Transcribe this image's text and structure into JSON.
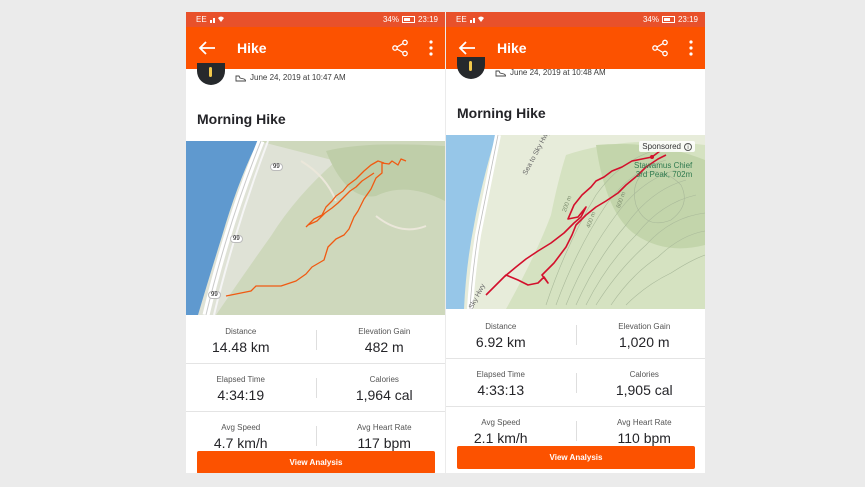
{
  "colors": {
    "accent": "#fc5200",
    "route_left": "#f05a12",
    "route_right": "#d3102c"
  },
  "phones": [
    {
      "status": {
        "carrier": "EE",
        "battery": "34%",
        "time": "23:19"
      },
      "header": {
        "title": "Hike"
      },
      "activity": {
        "date": "June 24, 2019 at 10:47 AM",
        "name": "Morning Hike"
      },
      "map": {
        "road_badges": [
          "99",
          "99",
          "99"
        ]
      },
      "stats": [
        {
          "label": "Distance",
          "value": "14.48 km"
        },
        {
          "label": "Elevation Gain",
          "value": "482 m"
        },
        {
          "label": "Elapsed Time",
          "value": "4:34:19"
        },
        {
          "label": "Calories",
          "value": "1,964 cal"
        },
        {
          "label": "Avg Speed",
          "value": "4.7 km/h"
        },
        {
          "label": "Avg Heart Rate",
          "value": "117 bpm"
        }
      ],
      "button": "View Analysis"
    },
    {
      "status": {
        "carrier": "EE",
        "battery": "34%",
        "time": "23:19"
      },
      "header": {
        "title": "Hike"
      },
      "activity": {
        "date": "June 24, 2019 at 10:48 AM",
        "name": "Morning Hike"
      },
      "map": {
        "sponsored": "Sponsored",
        "peak": "Stawamus Chief\n3rd Peak, 702m",
        "road": "Sea to Sky Hwy",
        "road_short": "Sky Hwy",
        "contour_labels": [
          "200 m",
          "400 m",
          "600 m"
        ]
      },
      "stats": [
        {
          "label": "Distance",
          "value": "6.92 km"
        },
        {
          "label": "Elevation Gain",
          "value": "1,020 m"
        },
        {
          "label": "Elapsed Time",
          "value": "4:33:13"
        },
        {
          "label": "Calories",
          "value": "1,905 cal"
        },
        {
          "label": "Avg Speed",
          "value": "2.1 km/h"
        },
        {
          "label": "Avg Heart Rate",
          "value": "110 bpm"
        }
      ],
      "button": "View Analysis"
    }
  ]
}
